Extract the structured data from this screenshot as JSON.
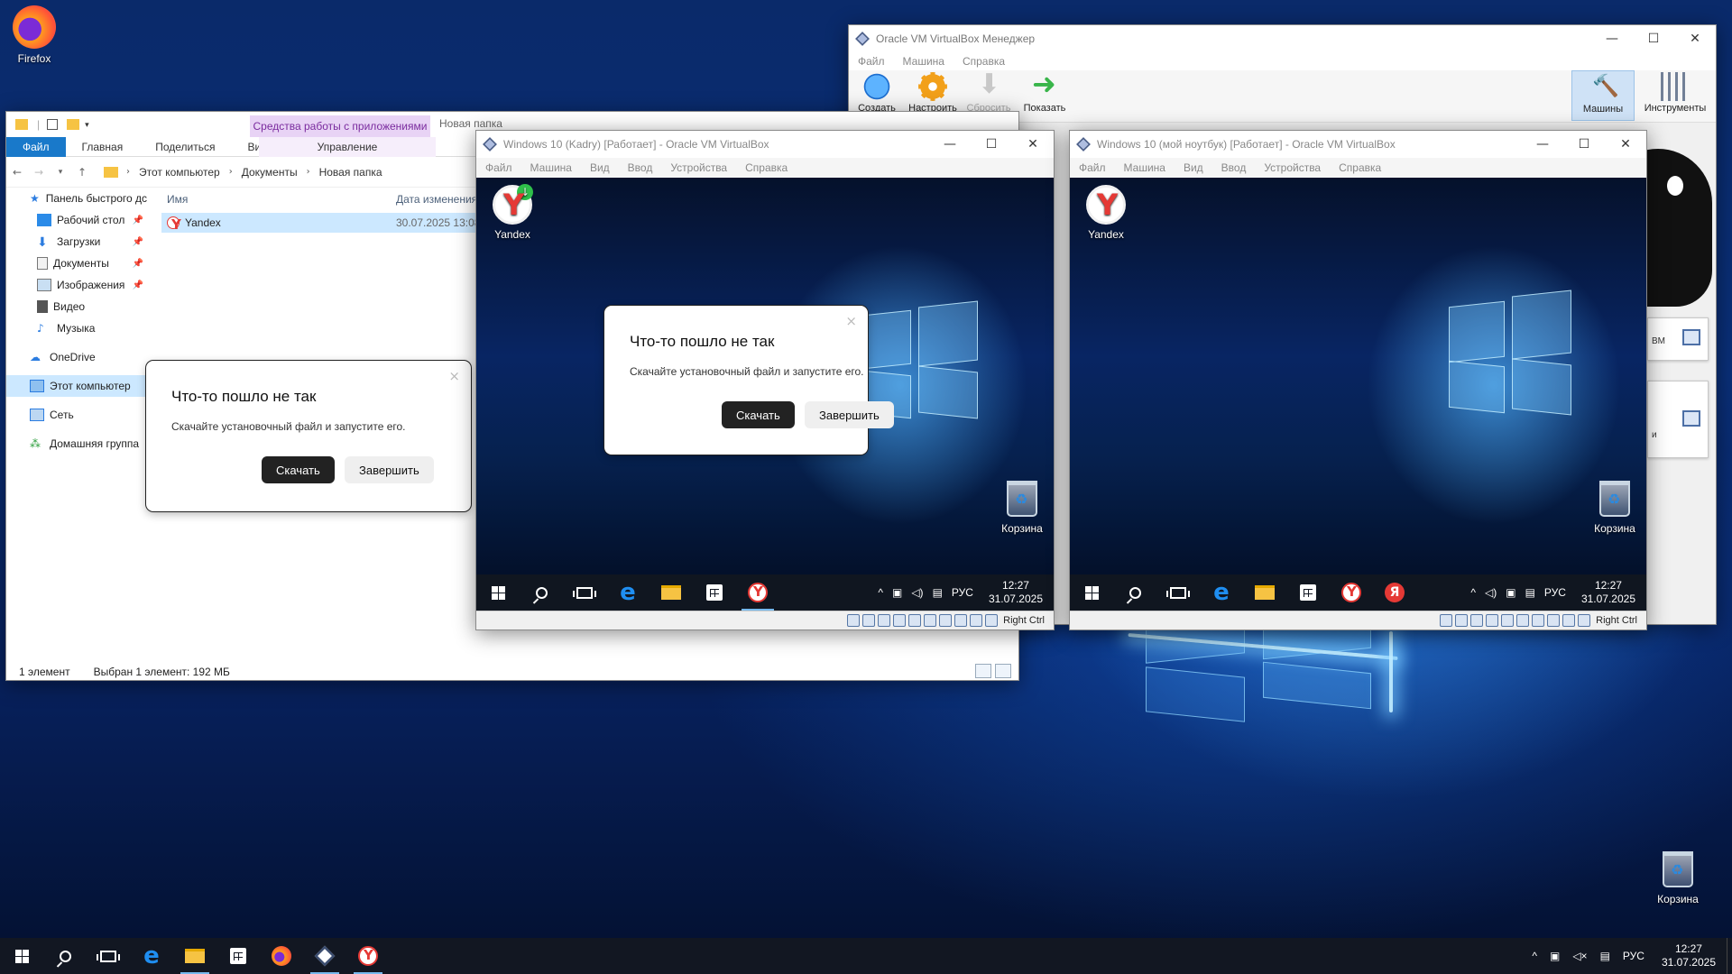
{
  "desktop": {
    "icons": {
      "firefox": "Firefox",
      "recycle_bin": "Корзина"
    }
  },
  "vbox_manager": {
    "title": "Oracle VM VirtualBox Менеджер",
    "menu": [
      "Файл",
      "Машина",
      "Справка"
    ],
    "toolbar": {
      "create": "Создать",
      "settings": "Настроить",
      "discard": "Сбросить",
      "show": "Показать",
      "machines": "Машины",
      "tools": "Инструменты"
    },
    "side_card_text": "ВМ",
    "side_card2_text": "и"
  },
  "explorer": {
    "ribbon_context": "Средства работы с приложениями",
    "title": "Новая папка",
    "tabs": {
      "file": "Файл",
      "home": "Главная",
      "share": "Поделиться",
      "view": "Вид",
      "manage": "Управление"
    },
    "breadcrumb": [
      "Этот компьютер",
      "Документы",
      "Новая папка"
    ],
    "nav": {
      "quick_access": "Панель быстрого дс",
      "desktop": "Рабочий стол",
      "downloads": "Загрузки",
      "documents": "Документы",
      "pictures": "Изображения",
      "video": "Видео",
      "music": "Музыка",
      "onedrive": "OneDrive",
      "this_pc": "Этот компьютер",
      "network": "Сеть",
      "homegroup": "Домашняя группа"
    },
    "columns": {
      "name": "Имя",
      "date": "Дата изменения"
    },
    "files": [
      {
        "name": "Yandex",
        "date": "30.07.2025 13:08"
      }
    ],
    "status": {
      "count": "1 элемент",
      "selected": "Выбран 1 элемент: 192 МБ"
    }
  },
  "error_dialog": {
    "title": "Что-то пошло не так",
    "message": "Скачайте установочный файл и запустите его.",
    "download_button": "Скачать",
    "finish_button": "Завершить",
    "close": "×"
  },
  "vm1": {
    "title": "Windows 10 (Kadry) [Работает] - Oracle VM VirtualBox",
    "menu": [
      "Файл",
      "Машина",
      "Вид",
      "Ввод",
      "Устройства",
      "Справка"
    ],
    "desktop_icons": {
      "yandex": "Yandex",
      "recycle_bin": "Корзина"
    },
    "tray": {
      "lang": "РУС",
      "time": "12:27",
      "date": "31.07.2025"
    },
    "host_key": "Right Ctrl"
  },
  "vm2": {
    "title": "Windows 10 (мой ноутбук) [Работает] - Oracle VM VirtualBox",
    "menu": [
      "Файл",
      "Машина",
      "Вид",
      "Ввод",
      "Устройства",
      "Справка"
    ],
    "desktop_icons": {
      "yandex": "Yandex",
      "recycle_bin": "Корзина"
    },
    "tray": {
      "lang": "РУС",
      "time": "12:27",
      "date": "31.07.2025"
    },
    "host_key": "Right Ctrl",
    "yandex_letter": "Я"
  },
  "host_taskbar": {
    "lang": "РУС",
    "time": "12:27",
    "date": "31.07.2025"
  },
  "window_controls": {
    "min": "—",
    "max": "☐",
    "close": "✕"
  }
}
